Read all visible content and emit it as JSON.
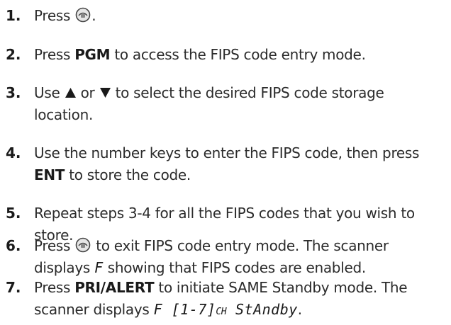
{
  "steps": [
    {
      "num": "1.",
      "t1": "Press ",
      "t2": "."
    },
    {
      "num": "2.",
      "t1": "Press ",
      "b1": "PGM",
      "t2": " to access the FIPS code entry mode."
    },
    {
      "num": "3.",
      "t1": "Use ",
      "t2": " or ",
      "t3": " to select the desired FIPS code storage location."
    },
    {
      "num": "4.",
      "t1": "Use the number keys to enter the FIPS code, then press ",
      "b1": "ENT",
      "t2": " to store the code."
    },
    {
      "num": "5.",
      "t1": "Repeat steps 3-4 for all the FIPS codes that you wish to store."
    },
    {
      "num": "6.",
      "t1": "Press ",
      "t2": " to exit FIPS code entry mode. The scanner displays ",
      "lcd1": "F",
      "t3": " showing that FIPS codes are enabled."
    },
    {
      "num": "7.",
      "t1": "Press ",
      "b1": "PRI/ALERT",
      "t2": " to initiate SAME Standby mode. The scanner displays ",
      "lcd1": "F [1-7]",
      "lcd2": "CH",
      "lcd3": " StAndby",
      "t3": "."
    }
  ],
  "icons": {
    "weather_button": "weather-button-icon",
    "up_arrow": "up-triangle-icon",
    "down_arrow": "down-triangle-icon"
  },
  "colors": {
    "text": "#2b2b2b",
    "icon_fill": "#e6e6e6",
    "icon_stroke": "#444444"
  }
}
